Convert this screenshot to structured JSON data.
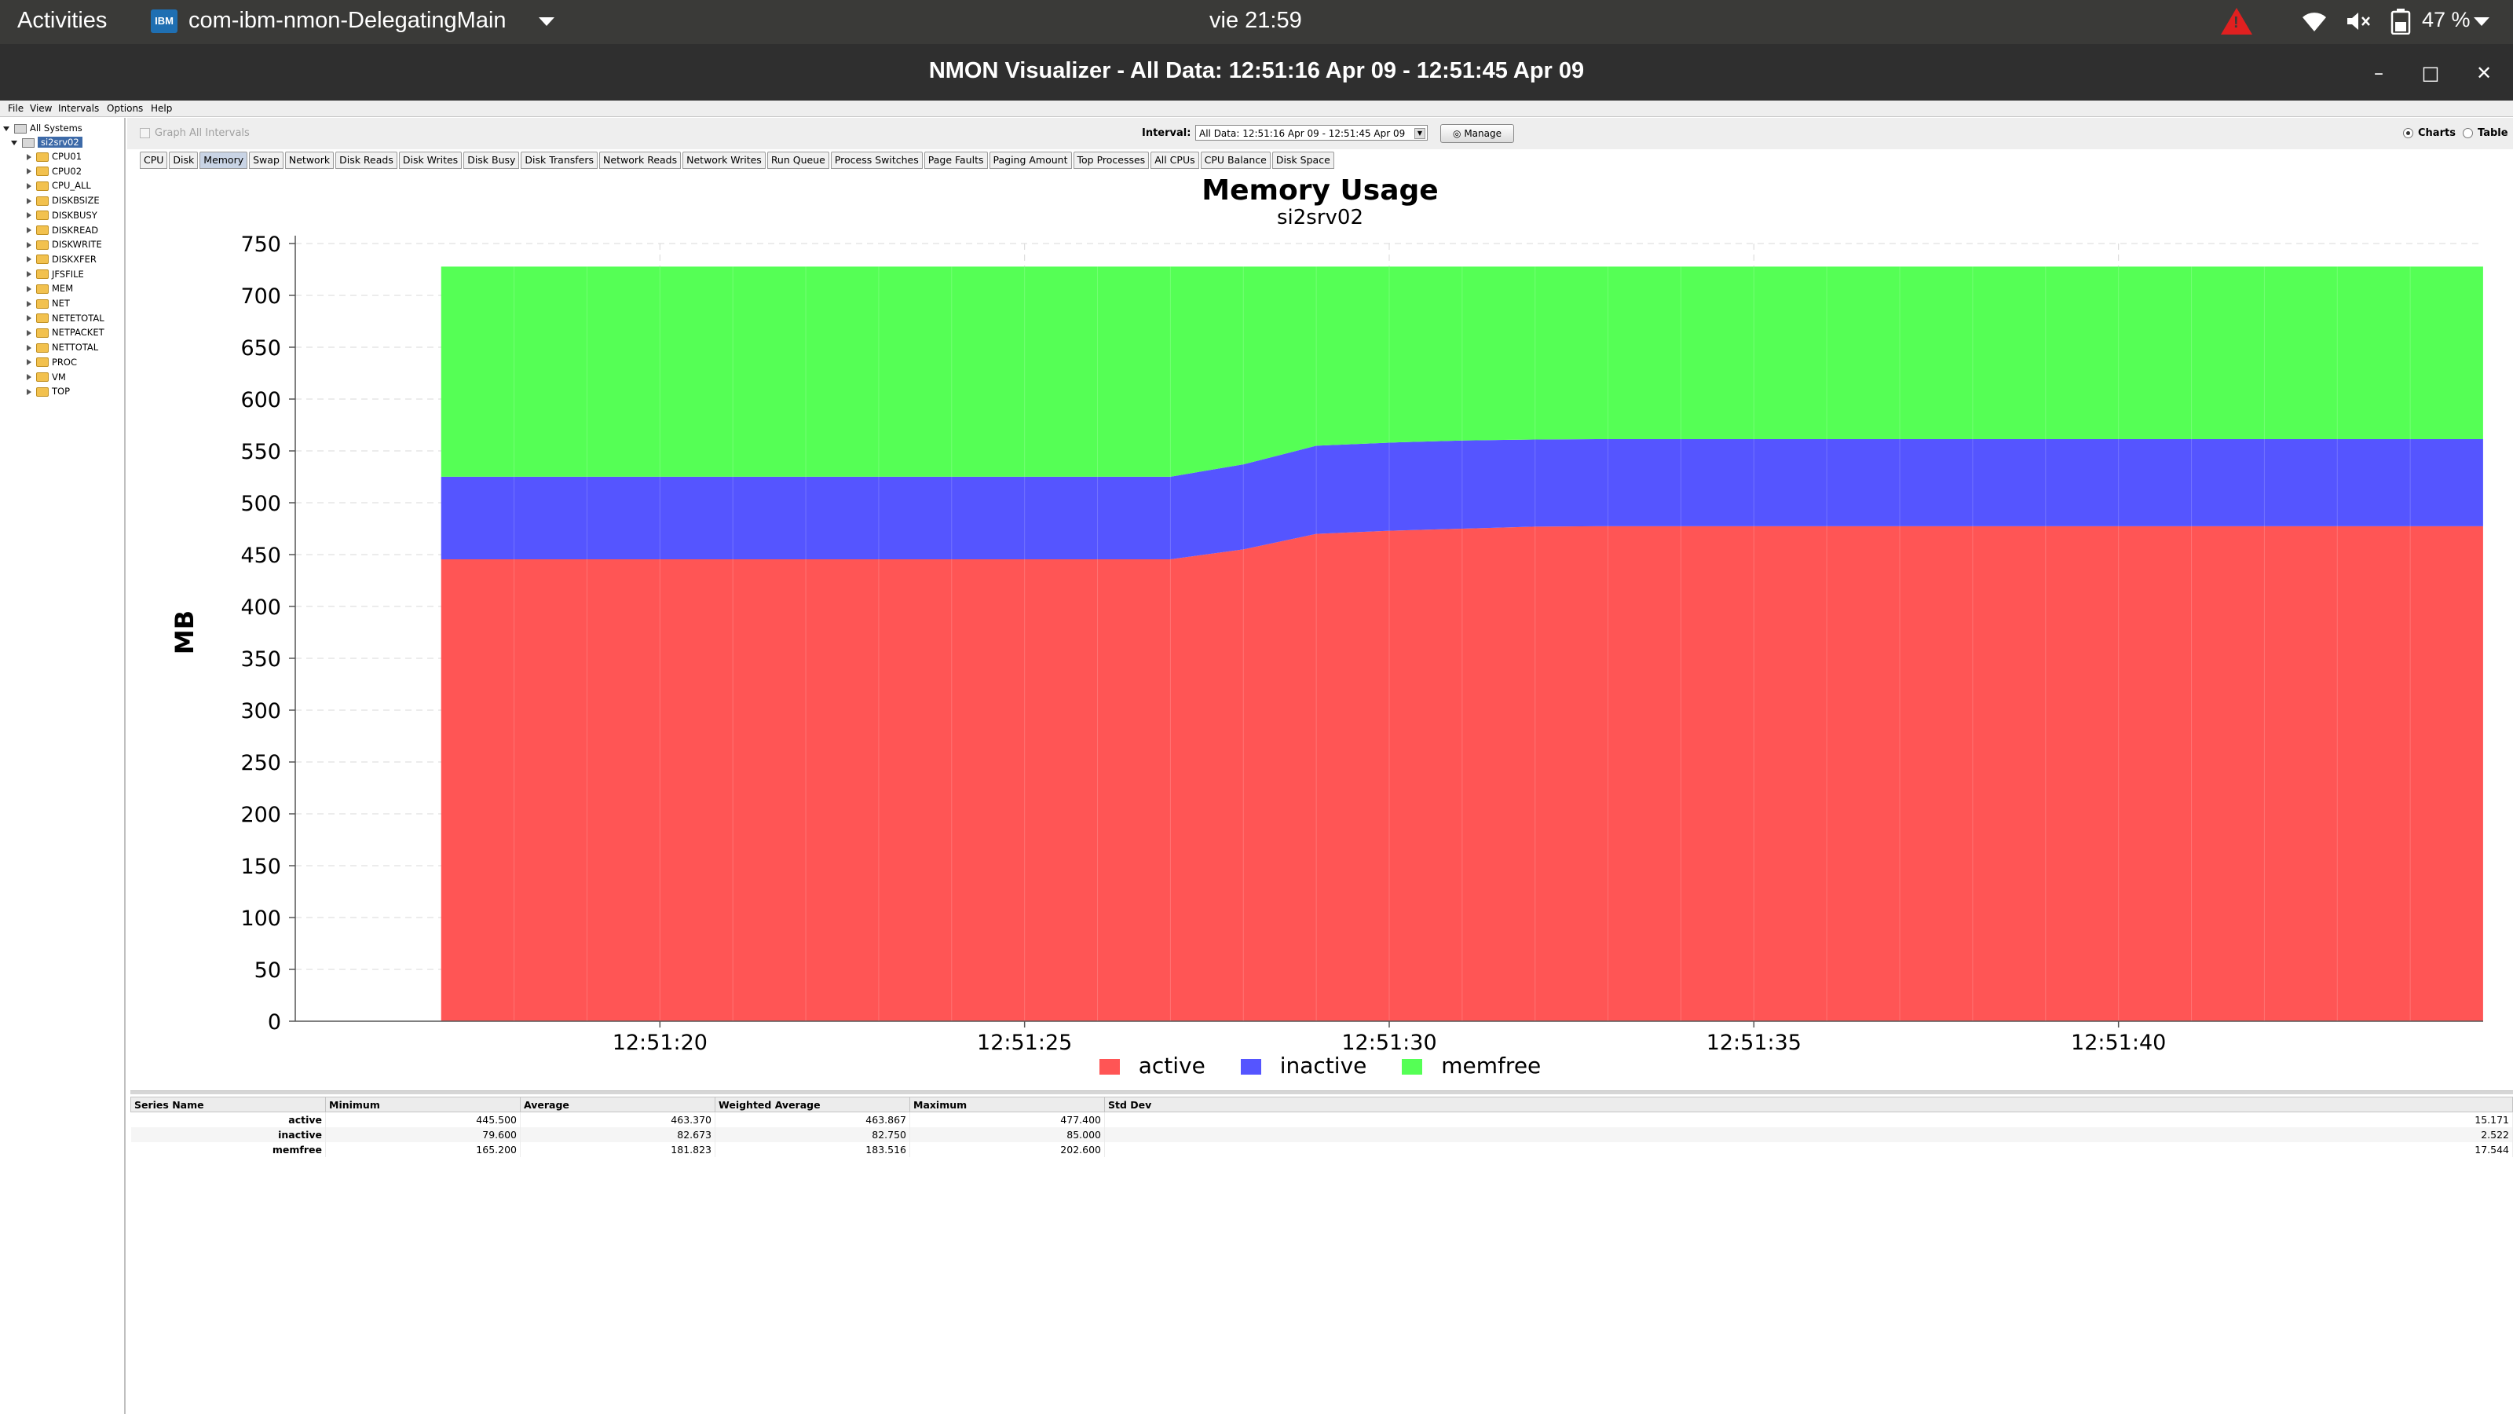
{
  "system_bar": {
    "activities": "Activities",
    "app_icon_label": "IBM",
    "app_name": "com-ibm-nmon-DelegatingMain",
    "clock": "vie 21:59",
    "battery": "47 %",
    "icons": [
      "warning-icon",
      "wifi-icon",
      "volume-muted-icon",
      "battery-icon",
      "chevron-down-icon"
    ]
  },
  "window": {
    "title": "NMON Visualizer - All Data: 12:51:16 Apr 09 - 12:51:45 Apr 09",
    "minimize": "–",
    "maximize": "□",
    "close": "✕"
  },
  "menu": [
    "File",
    "View",
    "Intervals",
    "Options",
    "Help"
  ],
  "tree": {
    "root": "All Systems",
    "system": "si2srv02",
    "items": [
      "CPU01",
      "CPU02",
      "CPU_ALL",
      "DISKBSIZE",
      "DISKBUSY",
      "DISKREAD",
      "DISKWRITE",
      "DISKXFER",
      "JFSFILE",
      "MEM",
      "NET",
      "NETETOTAL",
      "NETPACKET",
      "NETTOTAL",
      "PROC",
      "VM",
      "TOP"
    ]
  },
  "toolbar": {
    "graph_all": "Graph All Intervals",
    "interval_label": "Interval:",
    "interval_value": "All Data: 12:51:16 Apr 09 - 12:51:45 Apr 09",
    "manage": "Manage",
    "charts": "Charts",
    "table": "Table",
    "view_selected": "Charts"
  },
  "tabs": [
    "CPU",
    "Disk",
    "Memory",
    "Swap",
    "Network",
    "Disk Reads",
    "Disk Writes",
    "Disk Busy",
    "Disk Transfers",
    "Network Reads",
    "Network Writes",
    "Run Queue",
    "Process Switches",
    "Page Faults",
    "Paging Amount",
    "Top Processes",
    "All CPUs",
    "CPU Balance",
    "Disk Space"
  ],
  "active_tab": "Memory",
  "colors": {
    "active": "#ff5555",
    "inactive": "#5555ff",
    "memfree": "#55ff55"
  },
  "chart_data": {
    "type": "area",
    "stacked": true,
    "title": "Memory Usage",
    "subtitle": "si2srv02",
    "ylabel": "MB",
    "xlabel": "",
    "ylim": [
      0,
      750
    ],
    "yticks": [
      "0",
      "50",
      "100",
      "150",
      "200",
      "250",
      "300",
      "350",
      "400",
      "450",
      "500",
      "550",
      "600",
      "650",
      "700",
      "750"
    ],
    "xlim": [
      "12:51:15",
      "12:51:45"
    ],
    "xticks": [
      "12:51:20",
      "12:51:25",
      "12:51:30",
      "12:51:35",
      "12:51:40"
    ],
    "x": [
      "12:51:17",
      "12:51:18",
      "12:51:19",
      "12:51:20",
      "12:51:21",
      "12:51:22",
      "12:51:23",
      "12:51:24",
      "12:51:25",
      "12:51:26",
      "12:51:27",
      "12:51:28",
      "12:51:29",
      "12:51:30",
      "12:51:31",
      "12:51:32",
      "12:51:33",
      "12:51:34",
      "12:51:35",
      "12:51:36",
      "12:51:37",
      "12:51:38",
      "12:51:39",
      "12:51:40",
      "12:51:41",
      "12:51:42",
      "12:51:43",
      "12:51:44",
      "12:51:45"
    ],
    "series": [
      {
        "name": "active",
        "values": [
          445.5,
          445.5,
          445.5,
          445.5,
          445.5,
          445.5,
          445.5,
          445.5,
          445.5,
          445.5,
          445.5,
          455,
          470,
          473,
          475,
          477,
          477.4,
          477.4,
          477.4,
          477.4,
          477.4,
          477.4,
          477.4,
          477.4,
          477.4,
          477.4,
          477.4,
          477.4,
          477.4
        ]
      },
      {
        "name": "inactive",
        "values": [
          79.6,
          79.6,
          79.6,
          79.6,
          79.6,
          79.6,
          79.6,
          79.6,
          79.6,
          79.6,
          79.6,
          82,
          85,
          85,
          85,
          84,
          84,
          84,
          84,
          84,
          84,
          84,
          84,
          84,
          84,
          84,
          84,
          84,
          84
        ]
      },
      {
        "name": "memfree",
        "values": [
          202.6,
          202.6,
          202.6,
          202.6,
          202.6,
          202.6,
          202.6,
          202.6,
          202.6,
          202.6,
          202.6,
          190.7,
          172.7,
          169.7,
          167.7,
          166.7,
          166.3,
          166.3,
          166.3,
          166.3,
          166.3,
          166.3,
          166.3,
          166.3,
          166.3,
          166.3,
          166.3,
          166.3,
          166.3
        ]
      }
    ],
    "legend_position": "bottom",
    "grid": true
  },
  "stats": {
    "headers": [
      "Series Name",
      "Minimum",
      "Average",
      "Weighted Average",
      "Maximum",
      "Std Dev"
    ],
    "rows": [
      [
        "active",
        "445.500",
        "463.370",
        "463.867",
        "477.400",
        "15.171"
      ],
      [
        "inactive",
        "79.600",
        "82.673",
        "82.750",
        "85.000",
        "2.522"
      ],
      [
        "memfree",
        "165.200",
        "181.823",
        "183.516",
        "202.600",
        "17.544"
      ]
    ]
  }
}
